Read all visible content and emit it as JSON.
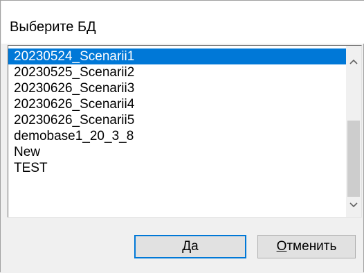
{
  "dialog": {
    "title": "Выберите БД"
  },
  "list": {
    "selected_index": 0,
    "items": [
      "20230524_Scenarii1",
      "20230525_Scenarii2",
      "20230626_Scenarii3",
      "20230626_Scenarii4",
      "20230626_Scenarii5",
      "demobase1_20_3_8",
      "New",
      "TEST"
    ]
  },
  "buttons": {
    "ok": {
      "mnemonic": "Д",
      "rest": "а"
    },
    "cancel": {
      "mnemonic": "О",
      "rest": "тменить"
    }
  },
  "icons": {
    "scroll_up": "chevron-up-icon",
    "scroll_down": "chevron-down-icon"
  },
  "colors": {
    "selection": "#0078d7",
    "default_button_border": "#0078d7"
  }
}
